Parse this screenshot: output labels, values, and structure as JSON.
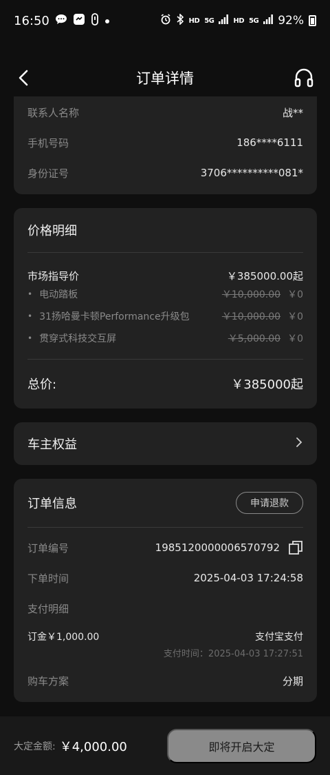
{
  "status_bar": {
    "time": "16:50",
    "left_icons": [
      "chat-bubble-icon",
      "messenger-icon",
      "lock-app-icon",
      "dot-icon"
    ],
    "hd1": "HD",
    "net1": "5G",
    "hd2": "HD",
    "net2": "5G",
    "battery": "92%"
  },
  "nav": {
    "title": "订单详情"
  },
  "contact": {
    "rows": [
      {
        "label": "联系人名称",
        "value": "战**"
      },
      {
        "label": "手机号码",
        "value": "186****6111"
      },
      {
        "label": "身份证号",
        "value": "3706**********081*"
      }
    ]
  },
  "price_detail": {
    "title": "价格明细",
    "msrp_label": "市场指导价",
    "msrp_value": "￥385000.00起",
    "options": [
      {
        "name": "电动踏板",
        "original": "￥10,000.00",
        "price": "￥0"
      },
      {
        "name": "31扬哈曼卡顿Performance升级包",
        "original": "￥10,000.00",
        "price": "￥0"
      },
      {
        "name": "贯穿式科技交互屏",
        "original": "￥5,000.00",
        "price": "￥0"
      }
    ],
    "total_label": "总价:",
    "total_value": "￥385000起"
  },
  "owner_rights": {
    "title": "车主权益"
  },
  "order_info": {
    "title": "订单信息",
    "refund_label": "申请退款",
    "number_label": "订单编号",
    "number_value": "1985120000006570792",
    "time_label": "下单时间",
    "time_value": "2025-04-03 17:24:58",
    "payment_label": "支付明细",
    "deposit_line": "订金￥1,000.00",
    "pay_method": "支付宝支付",
    "pay_time": "支付时间：2025-04-03 17:27:51",
    "plan_label": "购车方案",
    "plan_value": "分期"
  },
  "bottom": {
    "deposit_label": "大定金额:",
    "deposit_value": "￥4,000.00",
    "button_label": "即将开启大定"
  },
  "colors": {
    "background": "#0f0f0f",
    "card": "#222222",
    "button_disabled": "#8a8a8a"
  }
}
